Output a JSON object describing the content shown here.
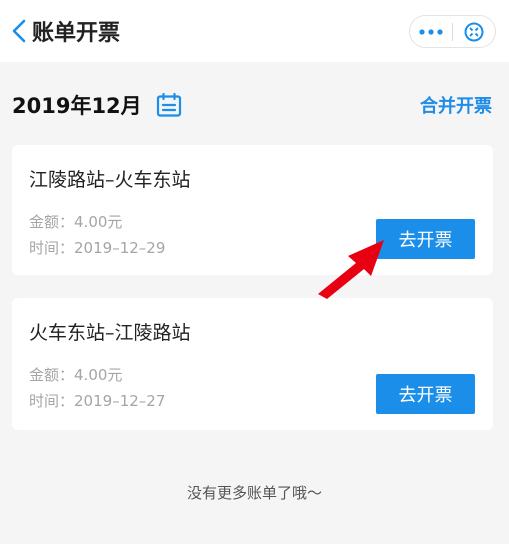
{
  "header": {
    "title": "账单开票"
  },
  "month": {
    "label": "2019年12月",
    "merge_label": "合并开票"
  },
  "bills": [
    {
      "route": "江陵路站–火车东站",
      "amount_label": "金额：",
      "amount": "4.00元",
      "date_label": "时间：",
      "date": "2019–12–29",
      "button_label": "去开票"
    },
    {
      "route": "火车东站–江陵路站",
      "amount_label": "金额：",
      "amount": "4.00元",
      "date_label": "时间：",
      "date": "2019–12–27",
      "button_label": "去开票"
    }
  ],
  "footer": {
    "note": "没有更多账单了哦～"
  },
  "icons": {
    "back": "chevron-left-icon",
    "more": "more-dots-icon",
    "close": "close-circle-icon",
    "calendar": "calendar-icon",
    "pointer": "red-arrow-icon"
  },
  "colors": {
    "accent": "#1a8ee8",
    "link": "#1e8ce8",
    "annotation": "#e60012",
    "background": "#f5f5f5"
  }
}
